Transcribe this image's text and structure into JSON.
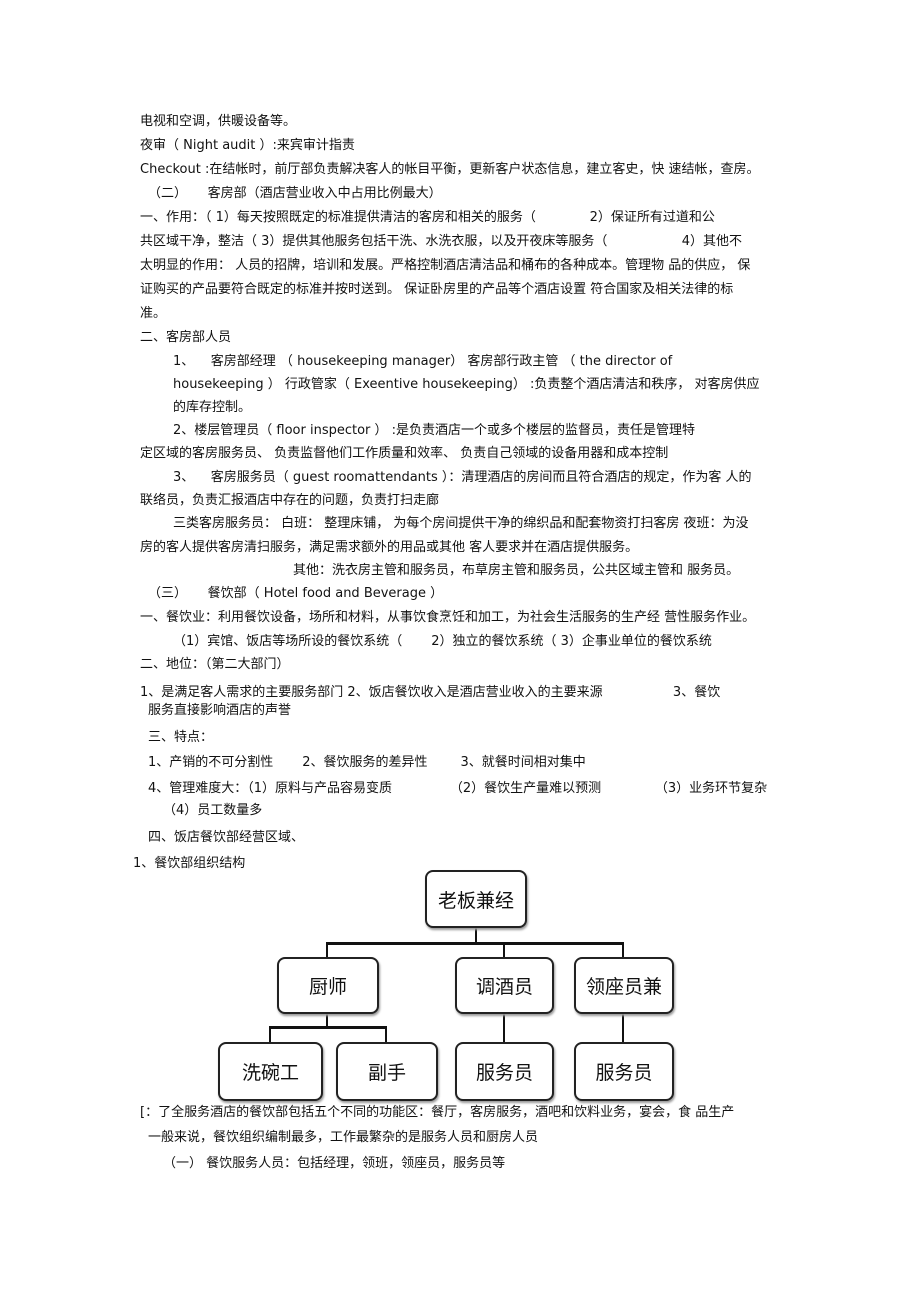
{
  "lines": [
    "电视和空调，供暖设备等。",
    "夜审（ Night audit ）:来宾审计指责",
    "Checkout :在结帐时，前厅部负责解决客人的帐目平衡，更新客户状态信息，建立客史，快 速结帐，查房。",
    "（二）     客房部（酒店营业收入中占用比例最大）",
    "一、作用：（ 1）每天按照既定的标准提供清洁的客房和相关的服务（             2）保证所有过道和公",
    "共区域干净，整洁（ 3）提供其他服务包括干洗、水洗衣服，以及开夜床等服务（                  4）其他不",
    "太明显的作用： 人员的招牌，培训和发展。严格控制酒店清洁品和桶布的各种成本。管理物 品的供应， 保",
    "证购买的产品要符合既定的标准并按时送到。 保证卧房里的产品等个酒店设置 符合国家及相关法律的标",
    "准。",
    "二、客房部人员",
    "1、    客房部经理 （ housekeeping manager） 客房部行政主管 （ the director of",
    "housekeeping ） 行政管家（ Exeentive housekeeping） :负责整个酒店清洁和秩序， 对客房供应",
    "的库存控制。",
    "2、楼层管理员（ floor inspector ） :是负责酒店一个或多个楼层的监督员，责任是管理特",
    "定区域的客房服务员、 负责监督他们工作质量和效率、 负责自己领域的设备用器和成本控制",
    "3、    客房服务员（ guest roomattendants ）：清理酒店的房间而且符合酒店的规定，作为客 人的",
    "联络员，负责汇报酒店中存在的问题，负责打扫走廊",
    "三类客房服务员： 白班： 整理床铺， 为每个房间提供干净的绵织品和配套物资打扫客房 夜班：为没",
    "房的客人提供客房清扫服务，满足需求额外的用品或其他 客人要求并在酒店提供服务。",
    "其他：洗衣房主管和服务员，布草房主管和服务员，公共区域主管和 服务员。",
    "（三）     餐饮部（ Hotel food and Beverage ）",
    "一、餐饮业：利用餐饮设备，场所和材料，从事饮食烹饪和加工，为社会生活服务的生产经 营性服务作业。",
    "（1）宾馆、饭店等场所设的餐饮系统（       2）独立的餐饮系统（ 3）企事业单位的餐饮系统",
    "二、地位：（第二大部门）",
    "1、是满足客人需求的主要服务部门 2、饭店餐饮收入是酒店营业收入的主要来源                 3、餐饮",
    "服务直接影响酒店的声誉",
    "三、特点：",
    "1、产销的不可分割性       2、餐饮服务的差异性        3、就餐时间相对集中",
    "4、管理难度大：（1）原料与产品容易变质              （2）餐饮生产量难以预测             （3）业务环节复杂",
    "（4）员工数量多",
    "四、饭店餐饮部经营区域、",
    "1、餐饮部组织结构",
    "[：了全服务酒店的餐饮部包括五个不同的功能区：餐厅，客房服务，酒吧和饮料业务，宴会，食 品生产",
    "一般来说，餐饮组织编制最多，工作最繁杂的是服务人员和厨房人员",
    "（一） 餐饮服务人员：包括经理，领班，领座员，服务员等"
  ],
  "org_chart": {
    "root": "老板兼经",
    "level2": [
      "厨师",
      "调酒员",
      "领座员兼"
    ],
    "level3": [
      "洗碗工",
      "副手",
      "服务员",
      "服务员"
    ]
  }
}
